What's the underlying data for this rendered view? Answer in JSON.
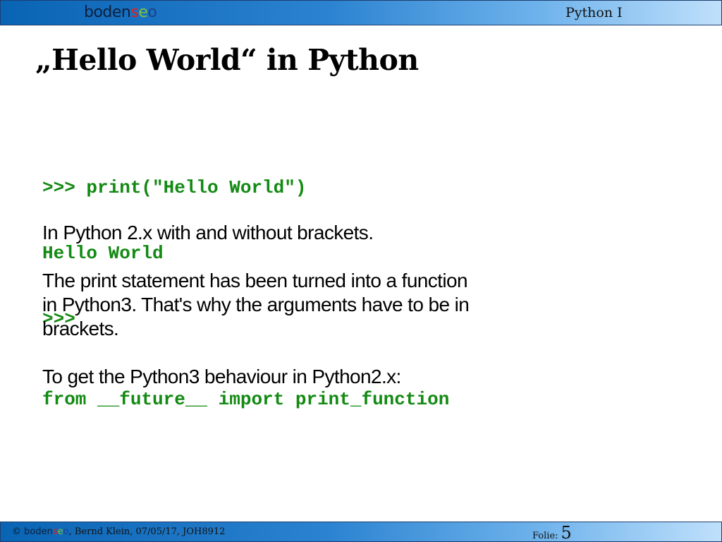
{
  "header": {
    "logo": {
      "part1": "boden",
      "part2": "s",
      "part3": "e",
      "part4": "o"
    },
    "course_title": "Python I"
  },
  "slide": {
    "title": "„Hello World“ in Python",
    "code_lines": [
      ">>> print(\"Hello World\")",
      "Hello World",
      ">>>"
    ],
    "paragraph1": "In Python 2.x with and without brackets.",
    "paragraph2_lines": [
      "The print statement has been turned into a function",
      "in Python3. That's why the arguments have to be in",
      "brackets."
    ],
    "paragraph3": "To get the Python3 behaviour in Python2.x:",
    "import_code": "from __future__ import print_function"
  },
  "footer": {
    "copyright_symbol": "©",
    "author_info": ", Bernd Klein, 07/05/17, JOH8912",
    "folie_label": "Folie:",
    "folie_number": "5"
  },
  "colors": {
    "code_green": "#138a13",
    "header_gradient_start": "#0a64b4",
    "header_gradient_end": "#bfe0fb",
    "logo_red": "#e0201b",
    "logo_green": "#7cc242"
  }
}
